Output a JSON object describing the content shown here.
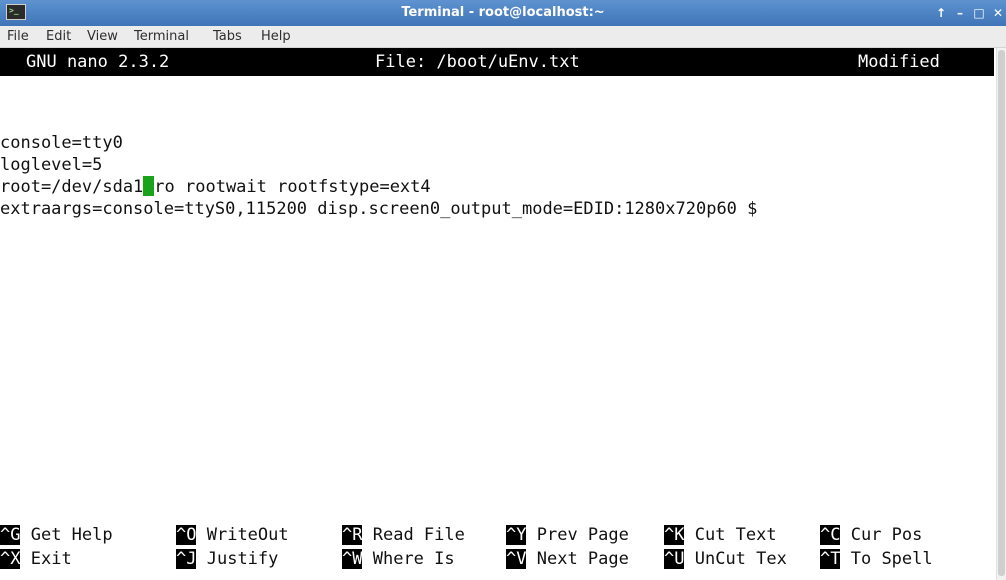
{
  "window": {
    "title": "Terminal - root@localhost:~",
    "icon": "terminal-app-icon",
    "controls": [
      {
        "name": "keep-above-icon",
        "glyph": "↑"
      },
      {
        "name": "minimize-icon",
        "glyph": "–"
      },
      {
        "name": "maximize-icon",
        "glyph": "□"
      },
      {
        "name": "close-icon",
        "glyph": "✕"
      }
    ],
    "titlebar_color": "#4a7fc0"
  },
  "menubar": {
    "items": [
      "File",
      "Edit",
      "View",
      "Terminal",
      "Tabs",
      "Help"
    ]
  },
  "nano": {
    "version": "GNU nano 2.3.2",
    "file": "File: /boot/uEnv.txt",
    "status": "Modified",
    "lines": [
      "",
      "console=tty0",
      "loglevel=5",
      "root=/dev/sda1",
      "extraargs=console=ttyS0,115200 disp.screen0_output_mode=EDID:1280x720p60 $"
    ],
    "line4_after_cursor": "ro rootwait rootfstype=ext4",
    "cursor_color": "#1aa31a",
    "shortcuts_row1": [
      {
        "key": "^G",
        "label": "Get Help"
      },
      {
        "key": "^O",
        "label": "WriteOut"
      },
      {
        "key": "^R",
        "label": "Read File"
      },
      {
        "key": "^Y",
        "label": "Prev Page"
      },
      {
        "key": "^K",
        "label": "Cut Text"
      },
      {
        "key": "^C",
        "label": "Cur Pos"
      }
    ],
    "shortcuts_row2": [
      {
        "key": "^X",
        "label": "Exit"
      },
      {
        "key": "^J",
        "label": "Justify"
      },
      {
        "key": "^W",
        "label": "Where Is"
      },
      {
        "key": "^V",
        "label": "Next Page"
      },
      {
        "key": "^U",
        "label": "UnCut Tex"
      },
      {
        "key": "^T",
        "label": "To Spell"
      }
    ]
  }
}
